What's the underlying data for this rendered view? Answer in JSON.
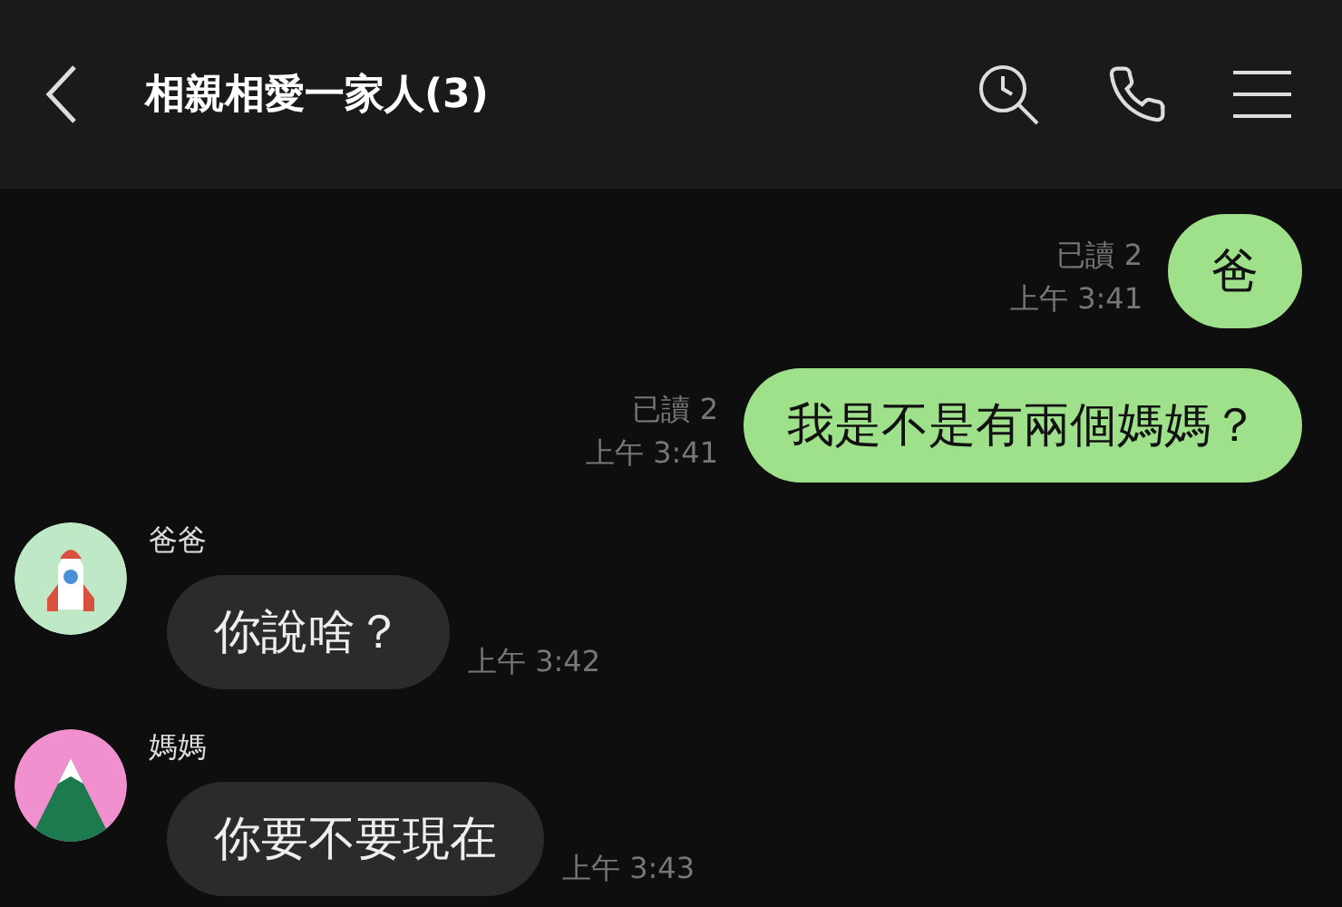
{
  "header": {
    "title": "相親相愛一家人(3)"
  },
  "messages": [
    {
      "kind": "out",
      "text": "爸",
      "read": "已讀 2",
      "time": "上午 3:41"
    },
    {
      "kind": "out",
      "text": "我是不是有兩個媽媽？",
      "read": "已讀 2",
      "time": "上午 3:41"
    },
    {
      "kind": "in",
      "sender": "爸爸",
      "avatar": {
        "kind": "rocket"
      },
      "text": "你說啥？",
      "time": "上午 3:42"
    },
    {
      "kind": "in",
      "sender": "媽媽",
      "avatar": {
        "kind": "mountain"
      },
      "text": "你要不要現在",
      "time": "上午 3:43"
    }
  ]
}
